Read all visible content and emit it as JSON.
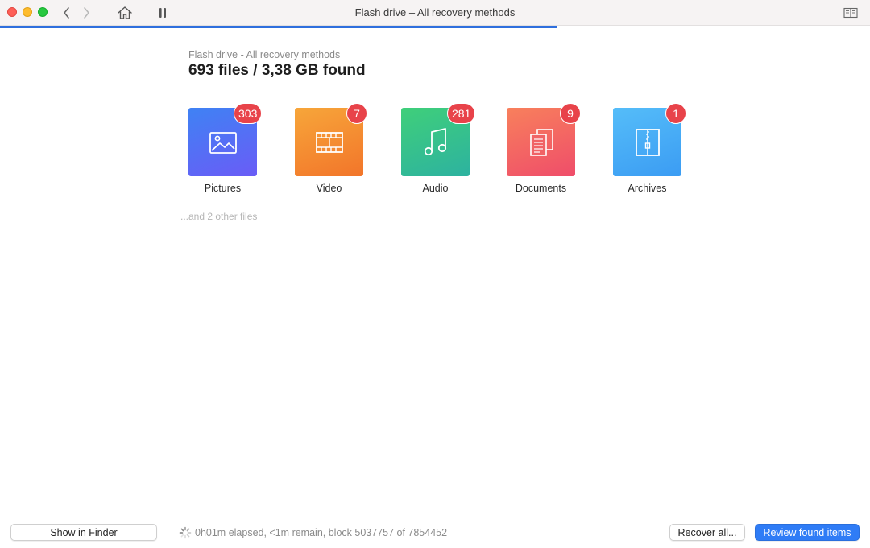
{
  "window": {
    "title": "Flash drive – All recovery methods"
  },
  "colors": {
    "accent": "#2f7cf6",
    "progress": "#2f6fdd",
    "badge": "#e8434a"
  },
  "scan": {
    "progress_fraction": 0.64
  },
  "header": {
    "subtitle": "Flash drive - All recovery methods",
    "headline": "693 files / 3,38 GB found"
  },
  "categories": [
    {
      "label": "Pictures",
      "count": "303",
      "icon": "image-icon",
      "gradient": [
        "#3f82f4",
        "#6a5cf6"
      ]
    },
    {
      "label": "Video",
      "count": "7",
      "icon": "film-icon",
      "gradient": [
        "#f7a63a",
        "#f2752a"
      ]
    },
    {
      "label": "Audio",
      "count": "281",
      "icon": "music-note-icon",
      "gradient": [
        "#3fcf7a",
        "#2db2a0"
      ]
    },
    {
      "label": "Documents",
      "count": "9",
      "icon": "documents-icon",
      "gradient": [
        "#f8805c",
        "#ef4d6a"
      ]
    },
    {
      "label": "Archives",
      "count": "1",
      "icon": "archive-zip-icon",
      "gradient": [
        "#55bdf9",
        "#3b9cf3"
      ]
    }
  ],
  "more_files": "...and 2 other files",
  "footer": {
    "show_in_finder": "Show in Finder",
    "status": "0h01m elapsed, <1m remain, block 5037757 of 7854452",
    "recover_all": "Recover all...",
    "review": "Review found items"
  }
}
